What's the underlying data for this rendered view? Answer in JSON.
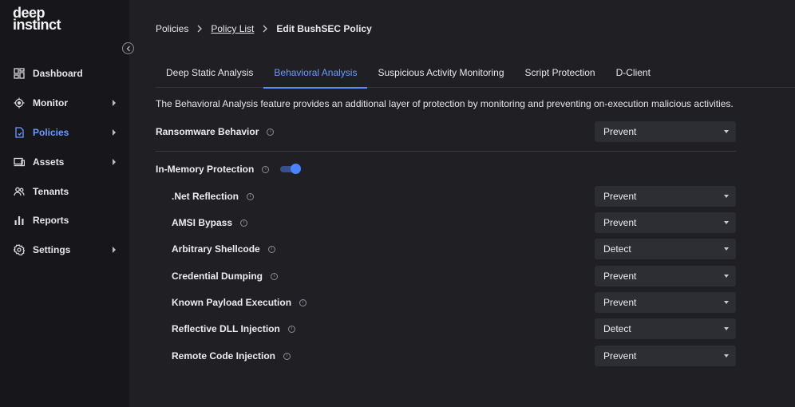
{
  "logo": {
    "line1": "deep",
    "line2": "instinct"
  },
  "sidebar": {
    "items": [
      {
        "label": "Dashboard",
        "icon": "dashboard-icon",
        "has_submenu": false,
        "active": false
      },
      {
        "label": "Monitor",
        "icon": "monitor-icon",
        "has_submenu": true,
        "active": false
      },
      {
        "label": "Policies",
        "icon": "policies-icon",
        "has_submenu": true,
        "active": true
      },
      {
        "label": "Assets",
        "icon": "assets-icon",
        "has_submenu": true,
        "active": false
      },
      {
        "label": "Tenants",
        "icon": "tenants-icon",
        "has_submenu": false,
        "active": false
      },
      {
        "label": "Reports",
        "icon": "reports-icon",
        "has_submenu": false,
        "active": false
      },
      {
        "label": "Settings",
        "icon": "settings-icon",
        "has_submenu": true,
        "active": false
      }
    ]
  },
  "breadcrumb": {
    "root": "Policies",
    "list": "Policy List",
    "current": "Edit BushSEC Policy"
  },
  "tabs": [
    {
      "label": "Deep Static Analysis",
      "active": false
    },
    {
      "label": "Behavioral Analysis",
      "active": true
    },
    {
      "label": "Suspicious Activity Monitoring",
      "active": false
    },
    {
      "label": "Script Protection",
      "active": false
    },
    {
      "label": "D-Client",
      "active": false
    }
  ],
  "description": "The Behavioral Analysis feature provides an additional layer of protection by monitoring and preventing on-execution malicious activities.",
  "ransomware": {
    "label": "Ransomware Behavior",
    "value": "Prevent"
  },
  "in_memory": {
    "label": "In-Memory Protection",
    "enabled": true
  },
  "sub_settings": [
    {
      "label": ".Net Reflection",
      "value": "Prevent"
    },
    {
      "label": "AMSI Bypass",
      "value": "Prevent"
    },
    {
      "label": "Arbitrary Shellcode",
      "value": "Detect"
    },
    {
      "label": "Credential Dumping",
      "value": "Prevent"
    },
    {
      "label": "Known Payload Execution",
      "value": "Prevent"
    },
    {
      "label": "Reflective DLL Injection",
      "value": "Detect"
    },
    {
      "label": "Remote Code Injection",
      "value": "Prevent"
    }
  ],
  "colors": {
    "accent": "#6c9bff",
    "background": "#1f1f24",
    "sidebar": "#17171b",
    "select_bg": "#2d2d34"
  }
}
